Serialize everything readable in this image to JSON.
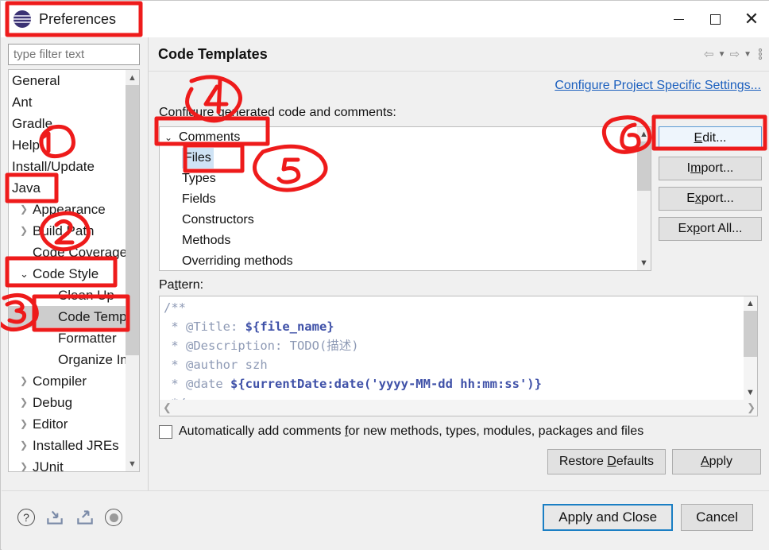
{
  "window": {
    "title": "Preferences",
    "logo_icon": "eclipse-logo",
    "minimize_label": "Minimize",
    "maximize_label": "Maximize",
    "close_label": "Close"
  },
  "sidebar": {
    "filter_placeholder": "type filter text",
    "filter_value": "",
    "scroll_up_icon": "chevron-up-icon",
    "scroll_down_icon": "chevron-down-icon",
    "scroll_left_icon": "chevron-left-icon",
    "scroll_right_icon": "chevron-right-icon",
    "items": [
      {
        "label": "General",
        "indent": 0,
        "arrow": "",
        "selected": false
      },
      {
        "label": "Ant",
        "indent": 0,
        "arrow": "",
        "selected": false
      },
      {
        "label": "Gradle",
        "indent": 0,
        "arrow": "",
        "selected": false
      },
      {
        "label": "Help",
        "indent": 0,
        "arrow": "",
        "selected": false
      },
      {
        "label": "Install/Update",
        "indent": 0,
        "arrow": "",
        "selected": false
      },
      {
        "label": "Java",
        "indent": 0,
        "arrow": "",
        "selected": false
      },
      {
        "label": "Appearance",
        "indent": 1,
        "arrow": "collapsed",
        "selected": false
      },
      {
        "label": "Build Path",
        "indent": 1,
        "arrow": "collapsed",
        "selected": false
      },
      {
        "label": "Code Coverage",
        "indent": 1,
        "arrow": "",
        "selected": false
      },
      {
        "label": "Code Style",
        "indent": 1,
        "arrow": "expanded",
        "selected": false
      },
      {
        "label": "Clean Up",
        "indent": 2,
        "arrow": "",
        "selected": false
      },
      {
        "label": "Code Templates",
        "indent": 2,
        "arrow": "",
        "selected": true
      },
      {
        "label": "Formatter",
        "indent": 2,
        "arrow": "",
        "selected": false
      },
      {
        "label": "Organize Imports",
        "indent": 2,
        "arrow": "",
        "selected": false
      },
      {
        "label": "Compiler",
        "indent": 1,
        "arrow": "collapsed",
        "selected": false
      },
      {
        "label": "Debug",
        "indent": 1,
        "arrow": "collapsed",
        "selected": false
      },
      {
        "label": "Editor",
        "indent": 1,
        "arrow": "collapsed",
        "selected": false
      },
      {
        "label": "Installed JREs",
        "indent": 1,
        "arrow": "collapsed",
        "selected": false
      },
      {
        "label": "JUnit",
        "indent": 1,
        "arrow": "collapsed",
        "selected": false
      }
    ]
  },
  "content": {
    "title": "Code Templates",
    "nav": {
      "back_icon": "arrow-left-icon",
      "back_dropdown_icon": "caret-down-icon",
      "forward_icon": "arrow-right-icon",
      "forward_dropdown_icon": "caret-down-icon",
      "menu_icon": "vertical-dots-icon"
    },
    "configure_link": "Configure Project Specific Settings...",
    "configure_label_prefix": "Conf",
    "configure_label_underlined": "i",
    "configure_label_suffix": "gure generated code and comments:",
    "template_tree": {
      "root": {
        "label": "Comments",
        "expanded": true,
        "chevron_icon": "chevron-down-icon"
      },
      "children": [
        {
          "label": "Files",
          "selected": true
        },
        {
          "label": "Types",
          "selected": false
        },
        {
          "label": "Fields",
          "selected": false
        },
        {
          "label": "Constructors",
          "selected": false
        },
        {
          "label": "Methods",
          "selected": false
        },
        {
          "label": "Overriding methods",
          "selected": false
        }
      ],
      "scroll_up_icon": "chevron-up-icon",
      "scroll_down_icon": "chevron-down-icon"
    },
    "side_buttons": [
      {
        "prefix": "",
        "mnemonic": "E",
        "suffix": "dit...",
        "focused": true
      },
      {
        "prefix": "I",
        "mnemonic": "m",
        "suffix": "port...",
        "focused": false
      },
      {
        "prefix": "E",
        "mnemonic": "x",
        "suffix": "port...",
        "focused": false
      },
      {
        "prefix": "Ex",
        "mnemonic": "p",
        "suffix": "ort All...",
        "focused": false
      }
    ],
    "pattern": {
      "label_prefix": "Pa",
      "label_mnemonic": "t",
      "label_suffix": "tern:",
      "lines": [
        {
          "parts": [
            {
              "t": "/**",
              "k": "c"
            }
          ]
        },
        {
          "parts": [
            {
              "t": " * @Title: ",
              "k": "c"
            },
            {
              "t": "${file_name}",
              "k": "v"
            }
          ]
        },
        {
          "parts": [
            {
              "t": " * @Description: TODO(描述)",
              "k": "c"
            }
          ]
        },
        {
          "parts": [
            {
              "t": " * @author szh",
              "k": "c"
            }
          ]
        },
        {
          "parts": [
            {
              "t": " * @date ",
              "k": "c"
            },
            {
              "t": "${currentDate:date('yyyy-MM-dd hh:mm:ss')}",
              "k": "v"
            }
          ]
        },
        {
          "parts": [
            {
              "t": " */",
              "k": "c"
            }
          ]
        }
      ],
      "scroll_up_icon": "chevron-up-icon",
      "scroll_down_icon": "chevron-down-icon",
      "scroll_left_icon": "chevron-left-icon",
      "scroll_right_icon": "chevron-right-icon"
    },
    "auto_comment_checkbox": {
      "checked": false,
      "prefix": "Automatically add comments ",
      "mnemonic": "f",
      "suffix": "or new methods, types, modules, packages and files"
    },
    "restore_defaults": {
      "prefix": "Restore ",
      "mnemonic": "D",
      "suffix": "efaults"
    },
    "apply": {
      "prefix": "",
      "mnemonic": "A",
      "suffix": "pply"
    }
  },
  "footer": {
    "help_icon": "question-mark-icon",
    "import_icon": "import-arrow-icon",
    "export_icon": "export-arrow-icon",
    "record_icon": "record-dot-icon",
    "apply_close_label": "Apply and Close",
    "cancel_label": "Cancel"
  },
  "annotations": {
    "marks": [
      "1",
      "2",
      "3",
      "4",
      "5",
      "6"
    ],
    "color": "#ee1b1b"
  }
}
